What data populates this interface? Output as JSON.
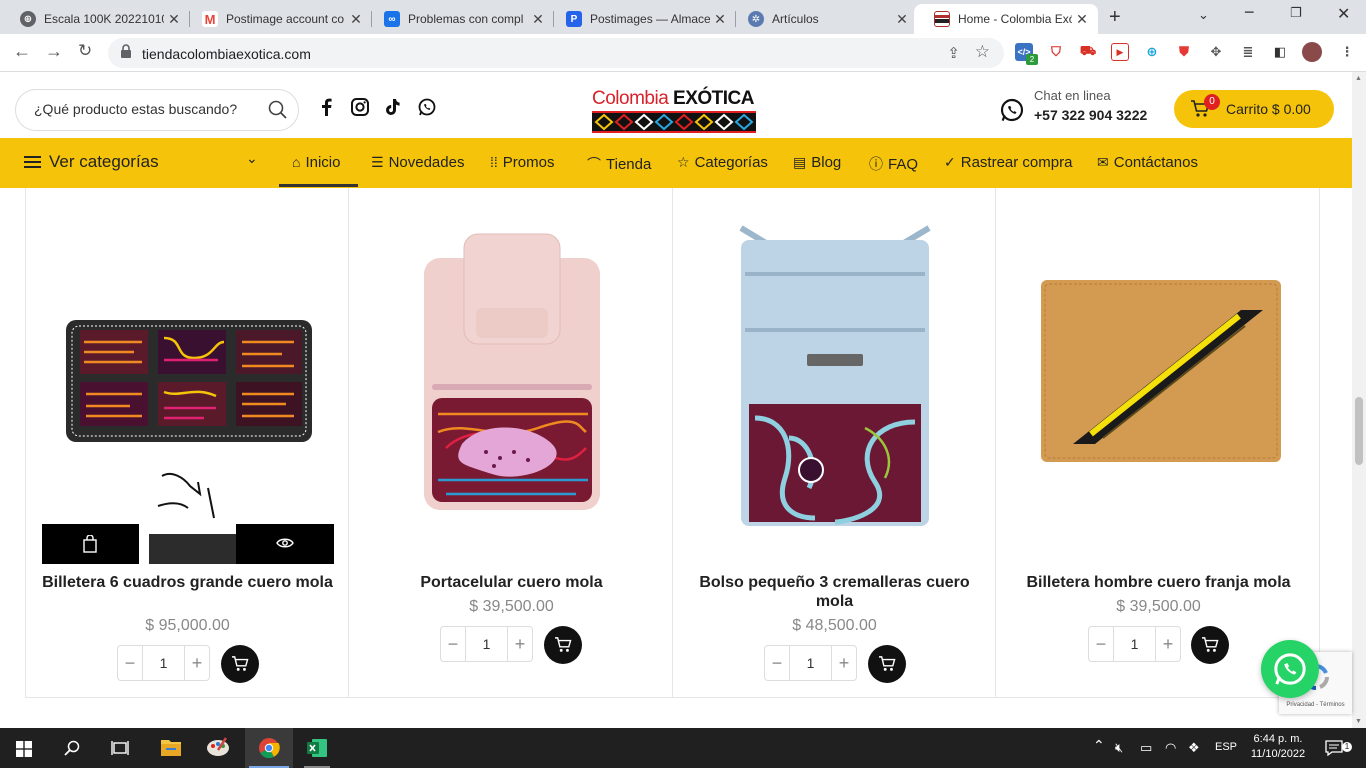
{
  "browser": {
    "tabs": [
      {
        "title": "Escala 100K 20221010",
        "favicon": "globe-icon",
        "color": "#5f6368"
      },
      {
        "title": "Postimage account co",
        "favicon": "gmail-icon",
        "color": "#ea4335"
      },
      {
        "title": "Problemas con compl",
        "favicon": "meet-icon",
        "color": "#1a73e8"
      },
      {
        "title": "Postimages — Almace",
        "favicon": "postimages-icon",
        "color": "#2563eb"
      },
      {
        "title": "Artículos",
        "favicon": "gear-globe-icon",
        "color": "#5b7bb0"
      },
      {
        "title": "Home - Colombia Exó",
        "favicon": "colombia-exotica-icon",
        "color": "#b03030"
      }
    ],
    "url": "tiendacolombiaexotica.com",
    "extension_badge": "2"
  },
  "header": {
    "search_placeholder": "¿Qué producto estas buscando?",
    "logo_text_1": "Colombia ",
    "logo_text_2": "EXÓTICA",
    "chat_label": "Chat en linea",
    "chat_phone": "+57 322 904 3222",
    "cart_count": "0",
    "cart_label": "Carrito",
    "cart_total": "$ 0.00",
    "accent": "#f5c40a"
  },
  "nav": {
    "categories_label": "Ver categorías",
    "items": [
      {
        "label": "Inicio",
        "icon": "home-icon",
        "glyph": "⌂"
      },
      {
        "label": "Novedades",
        "icon": "list-icon",
        "glyph": "☰"
      },
      {
        "label": "Promos",
        "icon": "grid-icon",
        "glyph": "⁞⁞"
      },
      {
        "label": "Tienda",
        "icon": "basket-icon",
        "glyph": "⌒"
      },
      {
        "label": "Categorías",
        "icon": "star-icon",
        "glyph": "☆"
      },
      {
        "label": "Blog",
        "icon": "newspaper-icon",
        "glyph": "▤"
      },
      {
        "label": "FAQ",
        "icon": "info-icon",
        "glyph": "ⓘ"
      },
      {
        "label": "Rastrear compra",
        "icon": "check-circle-icon",
        "glyph": "✓"
      },
      {
        "label": "Contáctanos",
        "icon": "envelope-icon",
        "glyph": "✉"
      }
    ]
  },
  "products": [
    {
      "name": "Billetera 6 cuadros grande cuero mola",
      "price": "$ 95,000.00",
      "qty": "1"
    },
    {
      "name": "Portacelular cuero mola",
      "price": "$ 39,500.00",
      "qty": "1"
    },
    {
      "name": "Bolso pequeño 3 cremalleras cuero mola",
      "price": "$ 48,500.00",
      "qty": "1"
    },
    {
      "name": "Billetera hombre cuero franja mola",
      "price": "$ 39,500.00",
      "qty": "1"
    }
  ],
  "recaptcha": {
    "text": "Privacidad - Términos"
  },
  "taskbar": {
    "lang": "ESP",
    "time": "6:44 p. m.",
    "date": "11/10/2022"
  }
}
